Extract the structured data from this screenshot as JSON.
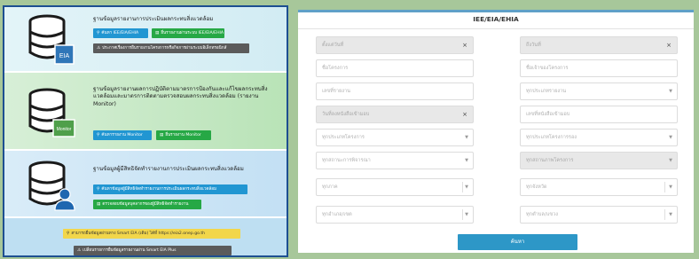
{
  "left": {
    "eia": {
      "title": "ฐานข้อมูลรายงานการประเมินผลกระทบสิ่งแวดล้อม",
      "badge": "EIA",
      "buttons": [
        "ค้นหา IEE/EIA/EHIA",
        "ยื่นรายงานผ่านระบบ IEE/EIA/EHIA",
        "ประกาศเรื่องการยื่นรายงานโครงการหรือกิจการผ่านระบบอิเล็กทรอนิกส์"
      ]
    },
    "monitor": {
      "title": "ฐานข้อมูลรายงานผลการปฏิบัติตามมาตรการป้องกันและแก้ไขผลกระทบสิ่งแวดล้อมและมาตรการติดตามตรวจสอบผลกระทบสิ่งแวดล้อม (รายงาน Monitor)",
      "badge": "Monitor",
      "buttons": [
        "ค้นหารายงาน Monitor",
        "ยื่นรายงาน Monitor"
      ]
    },
    "expert": {
      "title": "ฐานข้อมูลผู้มีสิทธิจัดทำรายงานการประเมินผลกระทบสิ่งแวดล้อม",
      "buttons": [
        "ค้นหาข้อมูลผู้มีสิทธิจัดทำรายงานการประเมินผลกระทบสิ่งแวดล้อม",
        "ตรวจสอบข้อมูลบุคลากรของผู้มีสิทธิจัดทำรายงาน"
      ]
    },
    "bottom": {
      "smart_eia": "สามารถยื่นข้อมูลผ่านทาง Smart EIA (เดิม) ได้ที่ https://eia2.onep.go.th",
      "smart_eia_plus": "เปลี่ยนรายการยื่นข้อมูลรายงานผ่าน Smart EIA Plus"
    }
  },
  "right": {
    "title": "IEE/EIA/EHIA",
    "search_label": "ค้นหา",
    "fields": {
      "start_date": "ตั้งแต่วันที่",
      "end_date": "ถึงวันที่",
      "project_name": "ชื่อโครงการ",
      "owner_name": "ชื่อเจ้าของโครงการ",
      "report_no": "เลขที่รายงาน",
      "report_type": "ทุกประเภทรายงาน",
      "doc_date": "วันที่ลงหนังสือเข้ามอบ",
      "doc_no": "เลขที่หนังสือเข้ามอบ",
      "project_type": "ทุกประเภทโครงการ",
      "project_subtype": "ทุกประเภทโครงการรอง",
      "consider_status": "ทุกสถานะการพิจารณา",
      "project_status": "ทุกสถานภาพโครงการ",
      "region": "ทุกภาค",
      "province": "ทุกจังหวัด",
      "district": "ทุกอำเภอ/เขต",
      "subdistrict": "ทุกตำบล/แขวง"
    }
  }
}
